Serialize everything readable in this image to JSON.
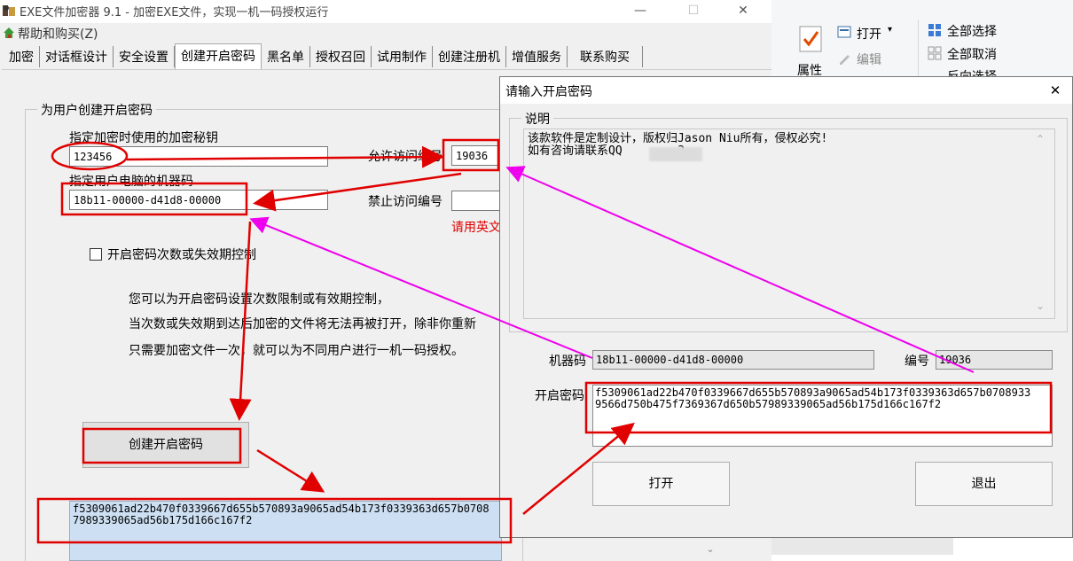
{
  "main_window": {
    "title": "EXE文件加密器 9.1 - 加密EXE文件，实现一机一码授权运行",
    "controls": {
      "minimize": "—",
      "maximize": "☐",
      "close": "✕"
    },
    "menu": {
      "help": "帮助和购买(Z)"
    },
    "tabs": [
      "加密",
      "对话框设计",
      "安全设置",
      "创建开启密码",
      "黑名单",
      "授权召回",
      "试用制作",
      "创建注册机",
      "增值服务",
      "联系购买"
    ],
    "active_tab": "创建开启密码",
    "group_title": "为用户创建开启密码",
    "key_label": "指定加密时使用的加密秘钥",
    "key_value": "123456",
    "machine_label": "指定用户电脑的机器码",
    "machine_value": "18b11-00000-d41d8-00000",
    "allow_label": "允许访问编号",
    "allow_value": "19036",
    "deny_label": "禁止访问编号",
    "deny_value": "",
    "hint_red": "请用英文",
    "checkbox_label": "开启密码次数或失效期控制",
    "checkbox_checked": false,
    "desc_lines": [
      "您可以为开启密码设置次数限制或有效期控制，",
      "当次数或失效期到达后加密的文件将无法再被打开，除非你重新",
      "只需要加密文件一次，就可以为不同用户进行一机一码授权。"
    ],
    "create_button": "创建开启密码",
    "output_text": "f5309061ad22b470f0339667d655b570893a9065ad54b173f0339363d657b0708\n7989339065ad56b175d166c167f2"
  },
  "ribbon": {
    "properties": "属性",
    "open": "打开",
    "edit": "编辑",
    "select_all": "全部选择",
    "select_none": "全部取消",
    "invert": "反向选择"
  },
  "dialog": {
    "title": "请输入开启密码",
    "close": "✕",
    "notes_label": "说明",
    "notes_text": "该款软件是定制设计，版权归Jason Niu所有，侵权必究!\n如有咨询请联系QQ        3",
    "machine_label": "机器码",
    "machine_value": "18b11-00000-d41d8-00000",
    "number_label": "编号",
    "number_value": "19036",
    "password_label": "开启密码",
    "password_value": "f5309061ad22b470f0339667d655b570893a9065ad54b173f0339363d657b0708933\n9566d750b475f7369367d650b57989339065ad56b175d166c167f2",
    "open_button": "打开",
    "exit_button": "退出"
  },
  "colors": {
    "annotation_red": "#e00000",
    "annotation_magenta": "#ee00ee",
    "output_bg": "#cde0f3"
  }
}
